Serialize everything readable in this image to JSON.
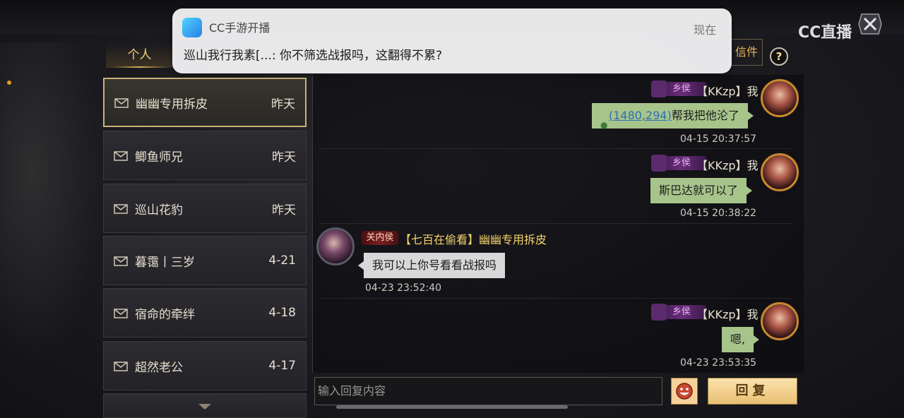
{
  "notification": {
    "app": "CC手游开播",
    "time": "现在",
    "message": "巡山我行我素[...: 你不筛选战报吗，这翻得不累?"
  },
  "overlay": {
    "cc_logo": "CC直播"
  },
  "tabs": {
    "personal": "个人",
    "mail": "信件",
    "help": "?"
  },
  "contacts": [
    {
      "name": "幽幽专用拆皮",
      "time": "昨天",
      "selected": true
    },
    {
      "name": "鲫鱼师兄",
      "time": "昨天"
    },
    {
      "name": "巡山花豹",
      "time": "昨天"
    },
    {
      "name": "暮霭丨三岁",
      "time": "4-21"
    },
    {
      "name": "宿命的牵绊",
      "time": "4-18"
    },
    {
      "name": "超然老公",
      "time": "4-17"
    }
  ],
  "messages": [
    {
      "side": "right",
      "rank": "乡侯",
      "sender": "【KKzp】我",
      "coord": "(1480,294)",
      "text": "帮我把他沦了",
      "timestamp": "04-15 20:37:57"
    },
    {
      "side": "right",
      "rank": "乡侯",
      "sender": "【KKzp】我",
      "text": "斯巴达就可以了",
      "timestamp": "04-15 20:38:22"
    },
    {
      "side": "left",
      "rank": "关内侯",
      "sender": "【七百在偷看】幽幽专用拆皮",
      "text": "我可以上你号看看战报吗",
      "timestamp": "04-23 23:52:40"
    },
    {
      "side": "right",
      "rank": "乡侯",
      "sender": "【KKzp】我",
      "text": "嗯,",
      "timestamp": "04-23 23:53:35"
    }
  ],
  "input": {
    "placeholder": "输入回复内容"
  },
  "buttons": {
    "reply": "回复"
  },
  "colors": {
    "accent_gold": "#f4d46a",
    "bubble_green": "#a7c48b",
    "bubble_gray": "#d8d8d8"
  }
}
